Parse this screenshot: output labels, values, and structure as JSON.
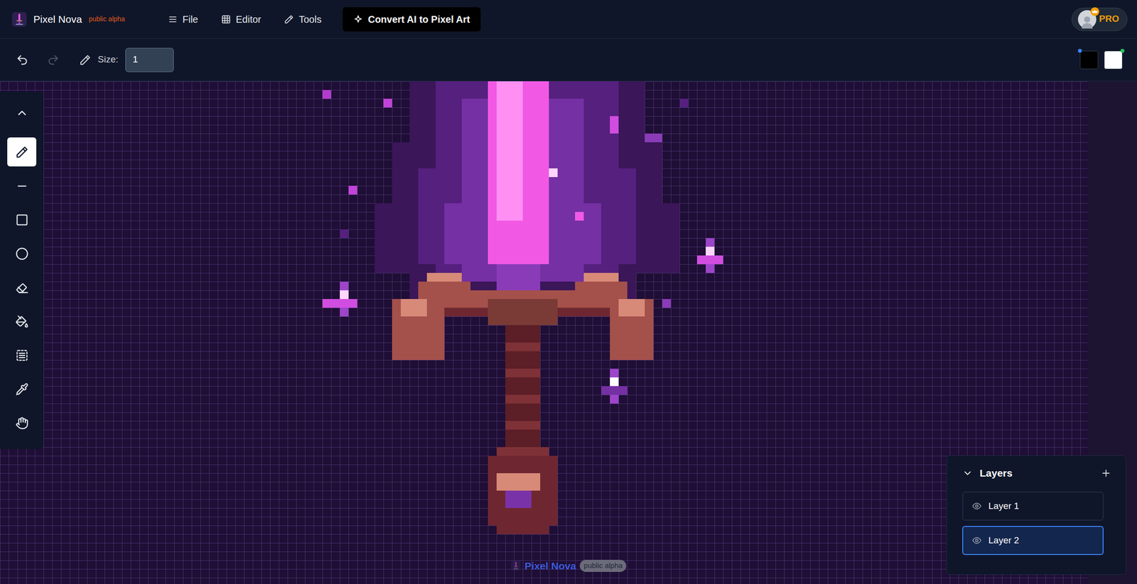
{
  "app": {
    "name": "Pixel Nova",
    "badge": "public alpha"
  },
  "menu": [
    {
      "label": "File",
      "kind": "menu"
    },
    {
      "label": "Editor",
      "kind": "grid"
    },
    {
      "label": "Tools",
      "kind": "pencil"
    }
  ],
  "convert_button": {
    "label": "Convert AI to Pixel Art"
  },
  "account": {
    "plan": "PRO"
  },
  "toolbar": {
    "undo_enabled": true,
    "redo_enabled": false,
    "size_label": "Size:",
    "size_value": "1",
    "primary_color": "#000000",
    "secondary_color": "#ffffff"
  },
  "tools": [
    {
      "kind": "chevron-up",
      "selected": false
    },
    {
      "kind": "pencil",
      "selected": true
    },
    {
      "kind": "line",
      "selected": false
    },
    {
      "kind": "square",
      "selected": false
    },
    {
      "kind": "circle",
      "selected": false
    },
    {
      "kind": "eraser",
      "selected": false
    },
    {
      "kind": "bucket",
      "selected": false
    },
    {
      "kind": "select",
      "selected": false
    },
    {
      "kind": "eyedropper",
      "selected": false
    },
    {
      "kind": "hand",
      "selected": false
    }
  ],
  "layers": {
    "title": "Layers",
    "expanded": true,
    "items": [
      {
        "label": "Layer 1",
        "visible": true,
        "selected": false
      },
      {
        "label": "Layer 2",
        "visible": true,
        "selected": true
      }
    ]
  },
  "watermark": {
    "name": "Pixel Nova",
    "badge": "public alpha"
  },
  "canvas": {
    "pixels": [
      [
        47,
        0,
        27,
        8,
        "#3b1658"
      ],
      [
        45,
        7,
        31,
        15,
        "#3b1658"
      ],
      [
        43,
        14,
        35,
        8,
        "#3b1658"
      ],
      [
        47,
        22,
        26,
        3,
        "#3b1658"
      ],
      [
        50,
        0,
        21,
        22,
        "#55207e"
      ],
      [
        48,
        10,
        25,
        11,
        "#55207e"
      ],
      [
        53,
        2,
        14,
        21,
        "#7530a3"
      ],
      [
        51,
        14,
        18,
        7,
        "#7530a3"
      ],
      [
        56,
        0,
        7,
        21,
        "#f159e5"
      ],
      [
        57,
        0,
        3,
        16,
        "#ff8ff3"
      ],
      [
        57,
        21,
        5,
        3,
        "#8a3cb8"
      ],
      [
        58,
        24,
        3,
        1,
        "#5d2480"
      ],
      [
        49,
        22,
        4,
        1,
        "#d88a78"
      ],
      [
        67,
        22,
        4,
        1,
        "#d88a78"
      ],
      [
        48,
        23,
        6,
        3,
        "#a4504b"
      ],
      [
        66,
        23,
        6,
        3,
        "#a4504b"
      ],
      [
        54,
        24,
        12,
        2,
        "#a4504b"
      ],
      [
        49,
        26,
        22,
        1,
        "#6e2730"
      ],
      [
        45,
        25,
        6,
        7,
        "#a4504b"
      ],
      [
        46,
        25,
        3,
        2,
        "#d88a78"
      ],
      [
        70,
        25,
        5,
        7,
        "#a4504b"
      ],
      [
        71,
        25,
        3,
        2,
        "#d88a78"
      ],
      [
        56,
        25,
        8,
        3,
        "#7a3b36"
      ],
      [
        58,
        28,
        4,
        17,
        "#5c1e27"
      ],
      [
        58,
        30,
        4,
        1,
        "#7e3136"
      ],
      [
        58,
        33,
        4,
        1,
        "#7e3136"
      ],
      [
        58,
        36,
        4,
        1,
        "#7e3136"
      ],
      [
        58,
        39,
        4,
        1,
        "#7e3136"
      ],
      [
        56,
        43,
        8,
        8,
        "#6e2730"
      ],
      [
        57,
        42,
        6,
        1,
        "#7e3136"
      ],
      [
        57,
        45,
        5,
        2,
        "#d88a78"
      ],
      [
        58,
        47,
        3,
        2,
        "#7a32a8"
      ],
      [
        57,
        51,
        6,
        1,
        "#6e2730"
      ],
      [
        37,
        1,
        1,
        1,
        "#b33bd0"
      ],
      [
        44,
        2,
        1,
        1,
        "#c044d8"
      ],
      [
        40,
        12,
        1,
        1,
        "#c044d8"
      ],
      [
        70,
        4,
        1,
        2,
        "#d04de0"
      ],
      [
        74,
        6,
        2,
        1,
        "#8a3cb8"
      ],
      [
        78,
        2,
        1,
        1,
        "#55207e"
      ],
      [
        66,
        15,
        1,
        1,
        "#f159e5"
      ],
      [
        63,
        10,
        1,
        1,
        "#ffd6fb"
      ],
      [
        76,
        25,
        1,
        1,
        "#8a3cb8"
      ],
      [
        39,
        17,
        1,
        1,
        "#55207e"
      ],
      [
        81,
        18,
        1,
        4,
        "#9c45c9"
      ],
      [
        80,
        20,
        3,
        1,
        "#d04de0"
      ],
      [
        81,
        19,
        1,
        1,
        "#ffd6fb"
      ],
      [
        39,
        23,
        1,
        4,
        "#9c45c9"
      ],
      [
        37,
        25,
        4,
        1,
        "#d04de0"
      ],
      [
        39,
        24,
        1,
        1,
        "#ffd6fb"
      ],
      [
        70,
        33,
        1,
        4,
        "#9c45c9"
      ],
      [
        69,
        35,
        3,
        1,
        "#7530a3"
      ],
      [
        70,
        34,
        1,
        1,
        "#ffffff"
      ]
    ]
  }
}
